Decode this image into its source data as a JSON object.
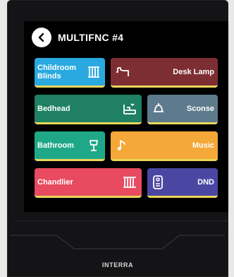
{
  "header": {
    "title": "MULTIFNC #4"
  },
  "tiles": {
    "childroom_blinds": {
      "label_line1": "Childroom",
      "label_line2": "Blinds"
    },
    "desk_lamp": {
      "label": "Desk Lamp"
    },
    "bedhead": {
      "label": "Bedhead"
    },
    "sconse": {
      "label": "Sconse"
    },
    "bathroom": {
      "label": "Bathroom"
    },
    "music": {
      "label": "Music"
    },
    "chandlier": {
      "label": "Chandlier"
    },
    "dnd": {
      "label": "DND"
    }
  },
  "brand": "INTERRA",
  "colors": {
    "blue": "#29a9e0",
    "brown": "#7d2e33",
    "teal": "#1f8062",
    "slate": "#5d7b8c",
    "green": "#1fa887",
    "orange": "#f4a838",
    "red": "#e84a5f",
    "indigo": "#4a47a3",
    "underline": "#e9d65a"
  },
  "icons": [
    "back-arrow-icon",
    "blinds-icon",
    "desk-lamp-icon",
    "bed-icon",
    "bell-lamp-icon",
    "floor-lamp-icon",
    "music-note-icon",
    "curtain-icon",
    "door-hanger-icon"
  ]
}
